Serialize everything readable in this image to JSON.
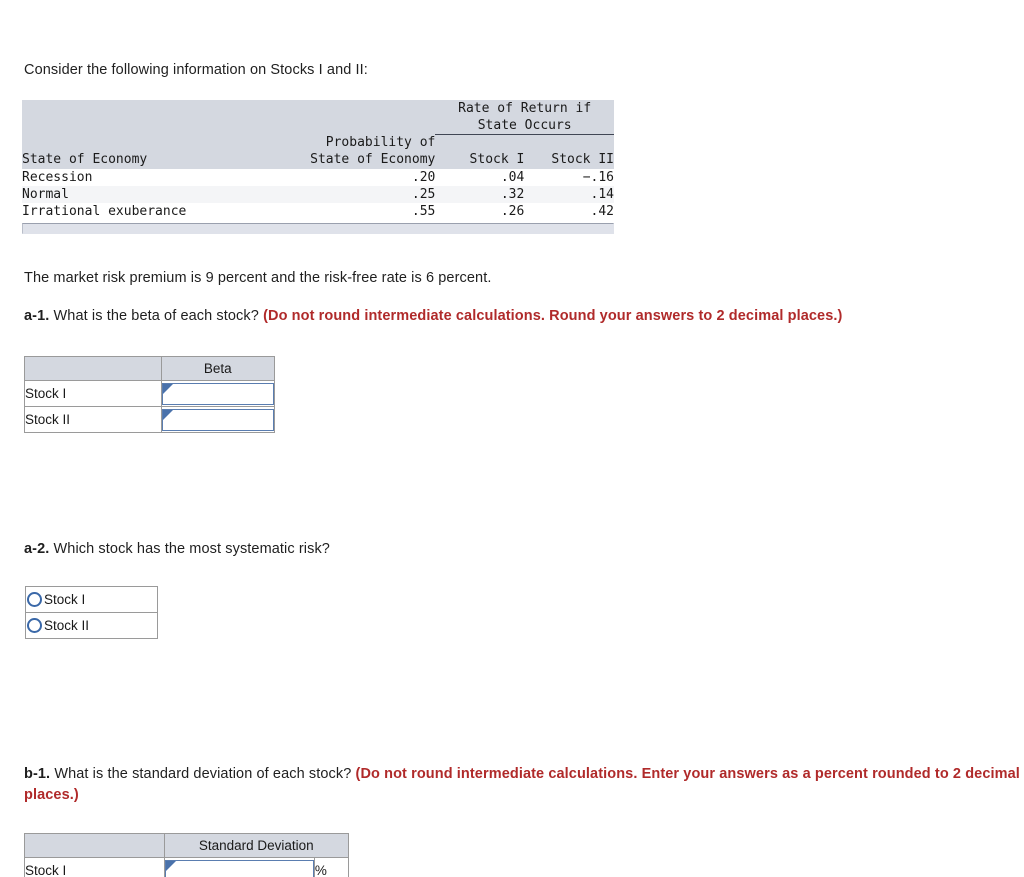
{
  "intro": {
    "text": "Consider the following information on Stocks I and II:"
  },
  "data_table": {
    "group_header": "Rate of Return if\nState Occurs",
    "group_header_line1": "Rate of Return if",
    "group_header_line2": "State Occurs",
    "prob_header_line1": "Probability of",
    "prob_header_line2": "State of Economy",
    "col_state": "State of Economy",
    "col_stock1": "Stock I",
    "col_stock2": "Stock II",
    "rows": [
      {
        "state": "Recession",
        "probability": ".20",
        "stock_i": ".04",
        "stock_ii": "−.16"
      },
      {
        "state": "Normal",
        "probability": ".25",
        "stock_i": ".32",
        "stock_ii": ".14"
      },
      {
        "state": "Irrational exuberance",
        "probability": ".55",
        "stock_i": ".26",
        "stock_ii": ".42"
      }
    ]
  },
  "premise": {
    "text": "The market risk premium is 9 percent and the risk-free rate is 6 percent."
  },
  "questions": {
    "a1": {
      "label": "a-1.",
      "text": " What is the beta of each stock? ",
      "note": "(Do not round intermediate calculations. Round your answers to 2 decimal places.)"
    },
    "a2": {
      "label": "a-2.",
      "text": " Which stock has the most systematic risk?"
    },
    "b1": {
      "label": "b-1.",
      "text": " What is the standard deviation of each stock? ",
      "note": "(Do not round intermediate calculations. Enter your answers as a percent rounded to 2 decimal places.)"
    }
  },
  "beta_table": {
    "header_blank": "",
    "header_beta": "Beta",
    "rows": [
      {
        "label": "Stock I",
        "value": ""
      },
      {
        "label": "Stock II",
        "value": ""
      }
    ]
  },
  "choices": {
    "options": [
      {
        "label": "Stock I",
        "selected": false
      },
      {
        "label": "Stock II",
        "selected": false
      }
    ]
  },
  "sd_table": {
    "header_blank": "",
    "header_sd": "Standard Deviation",
    "percent_symbol": "%",
    "rows": [
      {
        "label": "Stock I",
        "value": "",
        "unit": "%"
      }
    ]
  },
  "colors": {
    "header_band": "#d4d8e0",
    "stripe": "#f4f5f7",
    "input_border": "#5a7db0",
    "red_note": "#b02a2a",
    "radio_border": "#3a68a8",
    "rule": "#404654"
  }
}
